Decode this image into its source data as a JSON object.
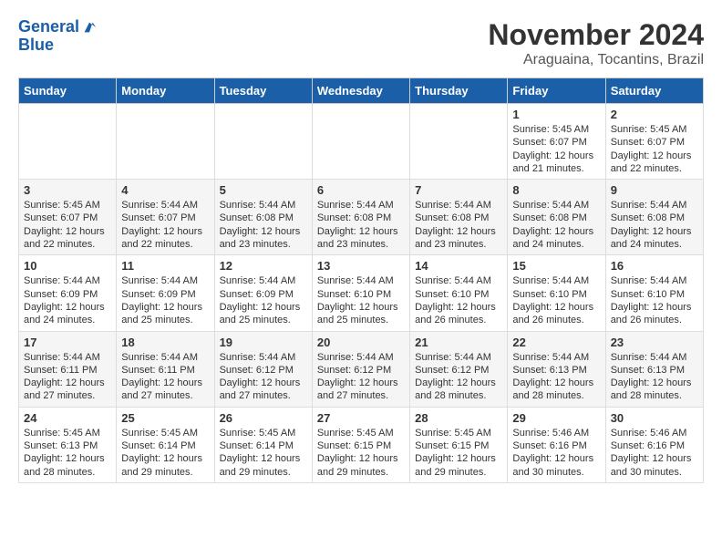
{
  "logo": {
    "line1": "General",
    "line2": "Blue"
  },
  "title": "November 2024",
  "subtitle": "Araguaina, Tocantins, Brazil",
  "weekdays": [
    "Sunday",
    "Monday",
    "Tuesday",
    "Wednesday",
    "Thursday",
    "Friday",
    "Saturday"
  ],
  "weeks": [
    [
      {
        "day": "",
        "info": ""
      },
      {
        "day": "",
        "info": ""
      },
      {
        "day": "",
        "info": ""
      },
      {
        "day": "",
        "info": ""
      },
      {
        "day": "",
        "info": ""
      },
      {
        "day": "1",
        "info": "Sunrise: 5:45 AM\nSunset: 6:07 PM\nDaylight: 12 hours and 21 minutes."
      },
      {
        "day": "2",
        "info": "Sunrise: 5:45 AM\nSunset: 6:07 PM\nDaylight: 12 hours and 22 minutes."
      }
    ],
    [
      {
        "day": "3",
        "info": "Sunrise: 5:45 AM\nSunset: 6:07 PM\nDaylight: 12 hours and 22 minutes."
      },
      {
        "day": "4",
        "info": "Sunrise: 5:44 AM\nSunset: 6:07 PM\nDaylight: 12 hours and 22 minutes."
      },
      {
        "day": "5",
        "info": "Sunrise: 5:44 AM\nSunset: 6:08 PM\nDaylight: 12 hours and 23 minutes."
      },
      {
        "day": "6",
        "info": "Sunrise: 5:44 AM\nSunset: 6:08 PM\nDaylight: 12 hours and 23 minutes."
      },
      {
        "day": "7",
        "info": "Sunrise: 5:44 AM\nSunset: 6:08 PM\nDaylight: 12 hours and 23 minutes."
      },
      {
        "day": "8",
        "info": "Sunrise: 5:44 AM\nSunset: 6:08 PM\nDaylight: 12 hours and 24 minutes."
      },
      {
        "day": "9",
        "info": "Sunrise: 5:44 AM\nSunset: 6:08 PM\nDaylight: 12 hours and 24 minutes."
      }
    ],
    [
      {
        "day": "10",
        "info": "Sunrise: 5:44 AM\nSunset: 6:09 PM\nDaylight: 12 hours and 24 minutes."
      },
      {
        "day": "11",
        "info": "Sunrise: 5:44 AM\nSunset: 6:09 PM\nDaylight: 12 hours and 25 minutes."
      },
      {
        "day": "12",
        "info": "Sunrise: 5:44 AM\nSunset: 6:09 PM\nDaylight: 12 hours and 25 minutes."
      },
      {
        "day": "13",
        "info": "Sunrise: 5:44 AM\nSunset: 6:10 PM\nDaylight: 12 hours and 25 minutes."
      },
      {
        "day": "14",
        "info": "Sunrise: 5:44 AM\nSunset: 6:10 PM\nDaylight: 12 hours and 26 minutes."
      },
      {
        "day": "15",
        "info": "Sunrise: 5:44 AM\nSunset: 6:10 PM\nDaylight: 12 hours and 26 minutes."
      },
      {
        "day": "16",
        "info": "Sunrise: 5:44 AM\nSunset: 6:10 PM\nDaylight: 12 hours and 26 minutes."
      }
    ],
    [
      {
        "day": "17",
        "info": "Sunrise: 5:44 AM\nSunset: 6:11 PM\nDaylight: 12 hours and 27 minutes."
      },
      {
        "day": "18",
        "info": "Sunrise: 5:44 AM\nSunset: 6:11 PM\nDaylight: 12 hours and 27 minutes."
      },
      {
        "day": "19",
        "info": "Sunrise: 5:44 AM\nSunset: 6:12 PM\nDaylight: 12 hours and 27 minutes."
      },
      {
        "day": "20",
        "info": "Sunrise: 5:44 AM\nSunset: 6:12 PM\nDaylight: 12 hours and 27 minutes."
      },
      {
        "day": "21",
        "info": "Sunrise: 5:44 AM\nSunset: 6:12 PM\nDaylight: 12 hours and 28 minutes."
      },
      {
        "day": "22",
        "info": "Sunrise: 5:44 AM\nSunset: 6:13 PM\nDaylight: 12 hours and 28 minutes."
      },
      {
        "day": "23",
        "info": "Sunrise: 5:44 AM\nSunset: 6:13 PM\nDaylight: 12 hours and 28 minutes."
      }
    ],
    [
      {
        "day": "24",
        "info": "Sunrise: 5:45 AM\nSunset: 6:13 PM\nDaylight: 12 hours and 28 minutes."
      },
      {
        "day": "25",
        "info": "Sunrise: 5:45 AM\nSunset: 6:14 PM\nDaylight: 12 hours and 29 minutes."
      },
      {
        "day": "26",
        "info": "Sunrise: 5:45 AM\nSunset: 6:14 PM\nDaylight: 12 hours and 29 minutes."
      },
      {
        "day": "27",
        "info": "Sunrise: 5:45 AM\nSunset: 6:15 PM\nDaylight: 12 hours and 29 minutes."
      },
      {
        "day": "28",
        "info": "Sunrise: 5:45 AM\nSunset: 6:15 PM\nDaylight: 12 hours and 29 minutes."
      },
      {
        "day": "29",
        "info": "Sunrise: 5:46 AM\nSunset: 6:16 PM\nDaylight: 12 hours and 30 minutes."
      },
      {
        "day": "30",
        "info": "Sunrise: 5:46 AM\nSunset: 6:16 PM\nDaylight: 12 hours and 30 minutes."
      }
    ]
  ]
}
